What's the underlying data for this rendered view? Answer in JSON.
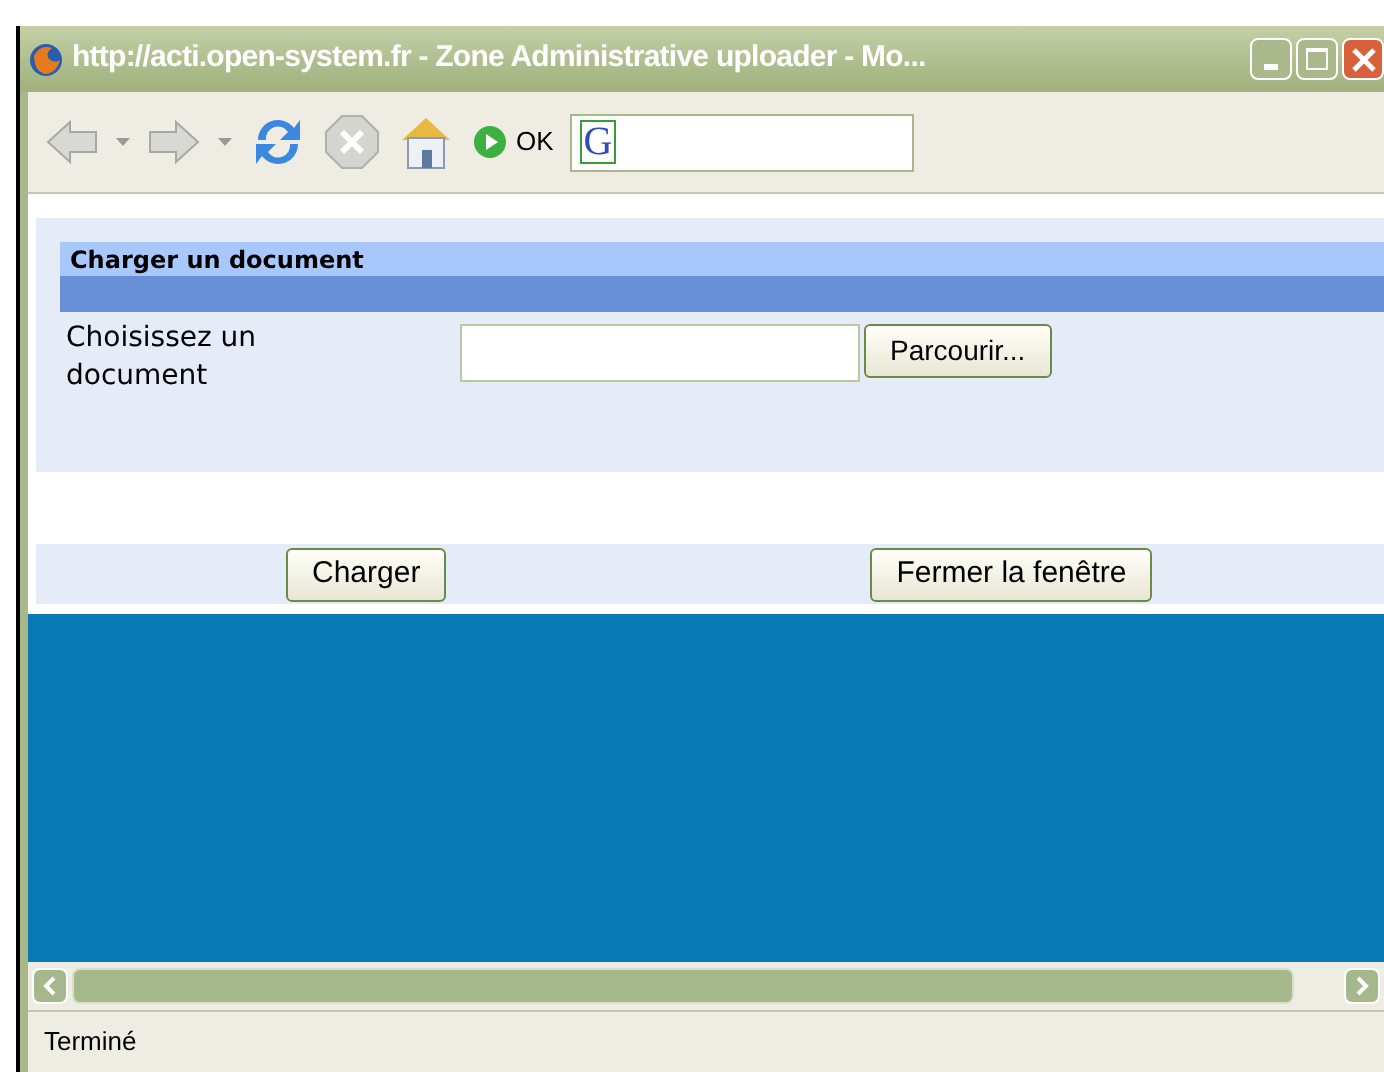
{
  "window": {
    "title": "http://acti.open-system.fr - Zone Administrative uploader - Mo..."
  },
  "toolbar": {
    "go_label": "OK",
    "search_letter": "G"
  },
  "panel": {
    "title": "Charger un document",
    "field_label": "Choisissez un document",
    "browse_button": "Parcourir..."
  },
  "buttons": [
    "Charger",
    "Fermer la fenêtre"
  ],
  "status_bar": "Terminé"
}
